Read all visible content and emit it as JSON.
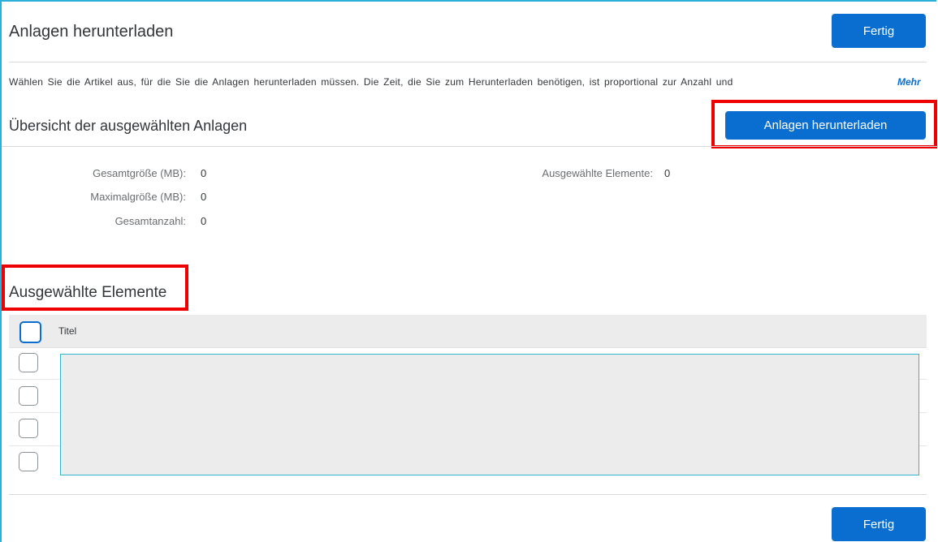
{
  "header": {
    "title": "Anlagen herunterladen",
    "done_label": "Fertig"
  },
  "info": {
    "text": "Wählen Sie die Artikel aus, für die Sie die Anlagen herunterladen müssen. Die Zeit, die Sie zum Herunterladen benötigen, ist proportional zur Anzahl und",
    "more_label": "Mehr"
  },
  "summary": {
    "title": "Übersicht der ausgewählten Anlagen",
    "download_label": "Anlagen herunterladen",
    "total_size_label": "Gesamtgröße (MB):",
    "total_size_value": "0",
    "max_size_label": "Maximalgröße (MB):",
    "max_size_value": "0",
    "total_count_label": "Gesamtanzahl:",
    "total_count_value": "0",
    "selected_label": "Ausgewählte Elemente:",
    "selected_value": "0"
  },
  "selected": {
    "title": "Ausgewählte Elemente",
    "columns": [
      "Titel"
    ]
  },
  "footer": {
    "done_label": "Fertig"
  },
  "colors": {
    "accent": "#0a6ed1",
    "highlight": "#ee0000",
    "frame": "#2bb0d8"
  }
}
